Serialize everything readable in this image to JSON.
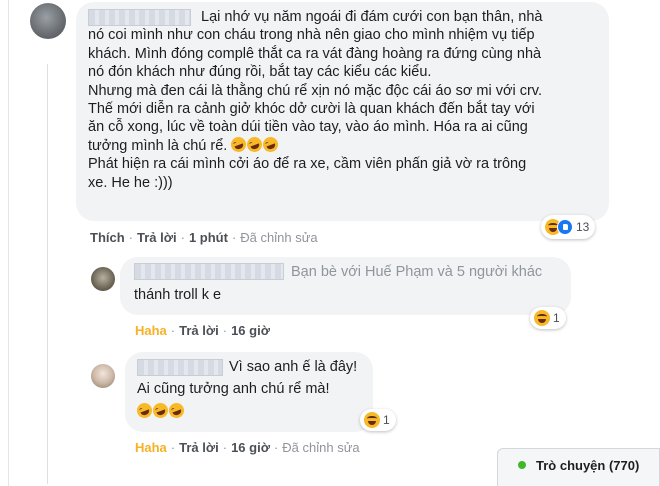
{
  "main_comment": {
    "lines": [
      "Lại nhớ vụ năm ngoái đi đám cưới con bạn thân, nhà",
      "nó coi mình như con cháu trong nhà nên giao cho mình nhiệm vụ tiếp",
      "khách. Mình đóng complê thắt ca ra vát đàng hoàng ra đứng cùng nhà",
      "nó đón khách như đúng rồi, bắt tay các kiểu các kiểu.",
      "Nhưng mà đen cái là thằng chú rể xịn nó mặc độc cái áo sơ mi với crv.",
      "Thế mới diễn ra cảnh giở khóc dở cười là quan khách đến bắt tay với",
      "ăn cỗ xong, lúc về toàn dúi tiền vào tay, vào áo mình. Hóa ra ai cũng",
      "tưởng mình là chú rể.",
      "Phát hiện ra cái mình cởi áo để ra xe, cầm viên phấn giả vờ ra trông",
      "xe. He he :)))"
    ],
    "emoji": "rofl-emoji",
    "actions": {
      "like": "Thích",
      "reply": "Trả lời",
      "time": "1 phút",
      "edited": "Đã chỉnh sửa"
    },
    "reaction_count": "13"
  },
  "reply_1": {
    "tag": "Bạn bè với Huế Phạm và 5 người khác",
    "text": "thánh troll k e",
    "actions": {
      "reaction": "Haha",
      "reply": "Trả lời",
      "time": "16 giờ"
    },
    "reaction_count": "1"
  },
  "reply_2": {
    "line1": "Vì sao anh ế là đây!",
    "line2": "Ai cũng tưởng anh chú rể mà!",
    "actions": {
      "reaction": "Haha",
      "reply": "Trả lời",
      "time": "16 giờ",
      "edited": "Đã chỉnh sửa"
    },
    "reaction_count": "1"
  },
  "chat": {
    "label": "Trò chuyện (770)"
  },
  "colors": {
    "bubble": "#f2f3f5",
    "haha": "#f7b125",
    "online": "#42b72a",
    "like_blue": "#1877f2"
  }
}
